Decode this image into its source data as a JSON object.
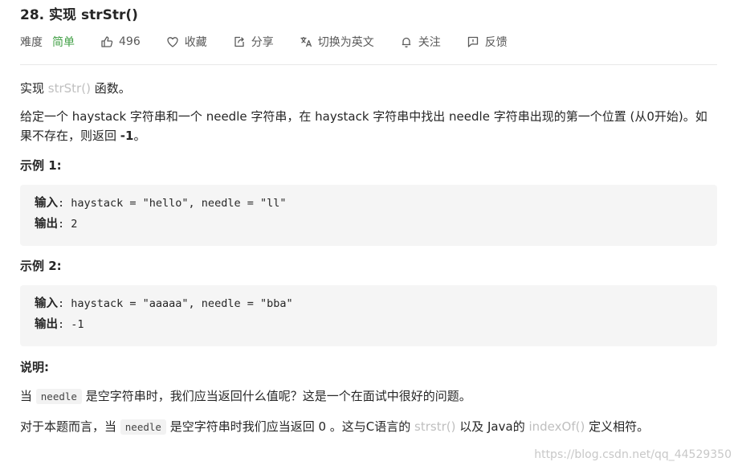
{
  "problem": {
    "title": "28. 实现 strStr()",
    "difficulty_label": "难度",
    "difficulty": "简单",
    "likes": "496",
    "actions": {
      "favorite": "收藏",
      "share": "分享",
      "switch_lang": "切换为英文",
      "follow": "关注",
      "feedback": "反馈"
    }
  },
  "content": {
    "intro_prefix": "实现 ",
    "intro_link": "strStr()",
    "intro_suffix": " 函数。",
    "desc_main": "给定一个 haystack 字符串和一个 needle 字符串，在 haystack 字符串中找出 needle 字符串出现的第一个位置 (从0开始)。如果不存在，则返回 ",
    "desc_bold": " -1",
    "desc_end": "。",
    "example1_title": "示例 1:",
    "example1_input_label": "输入",
    "example1_input": ": haystack = \"hello\", needle = \"ll\"",
    "example1_output_label": "输出",
    "example1_output": ": 2",
    "example2_title": "示例 2:",
    "example2_input_label": "输入",
    "example2_input": ": haystack = \"aaaaa\", needle = \"bba\"",
    "example2_output_label": "输出",
    "example2_output": ": -1",
    "note_title": "说明:",
    "note1_prefix": "当 ",
    "note1_code": "needle",
    "note1_suffix": " 是空字符串时，我们应当返回什么值呢？这是一个在面试中很好的问题。",
    "note2_prefix": "对于本题而言，当 ",
    "note2_code": "needle",
    "note2_mid": " 是空字符串时我们应当返回 0 。这与C语言的 ",
    "note2_link1": "strstr()",
    "note2_mid2": " 以及 Java的 ",
    "note2_link2": "indexOf()",
    "note2_end": " 定义相符。"
  },
  "watermark": "https://blog.csdn.net/qq_44529350"
}
